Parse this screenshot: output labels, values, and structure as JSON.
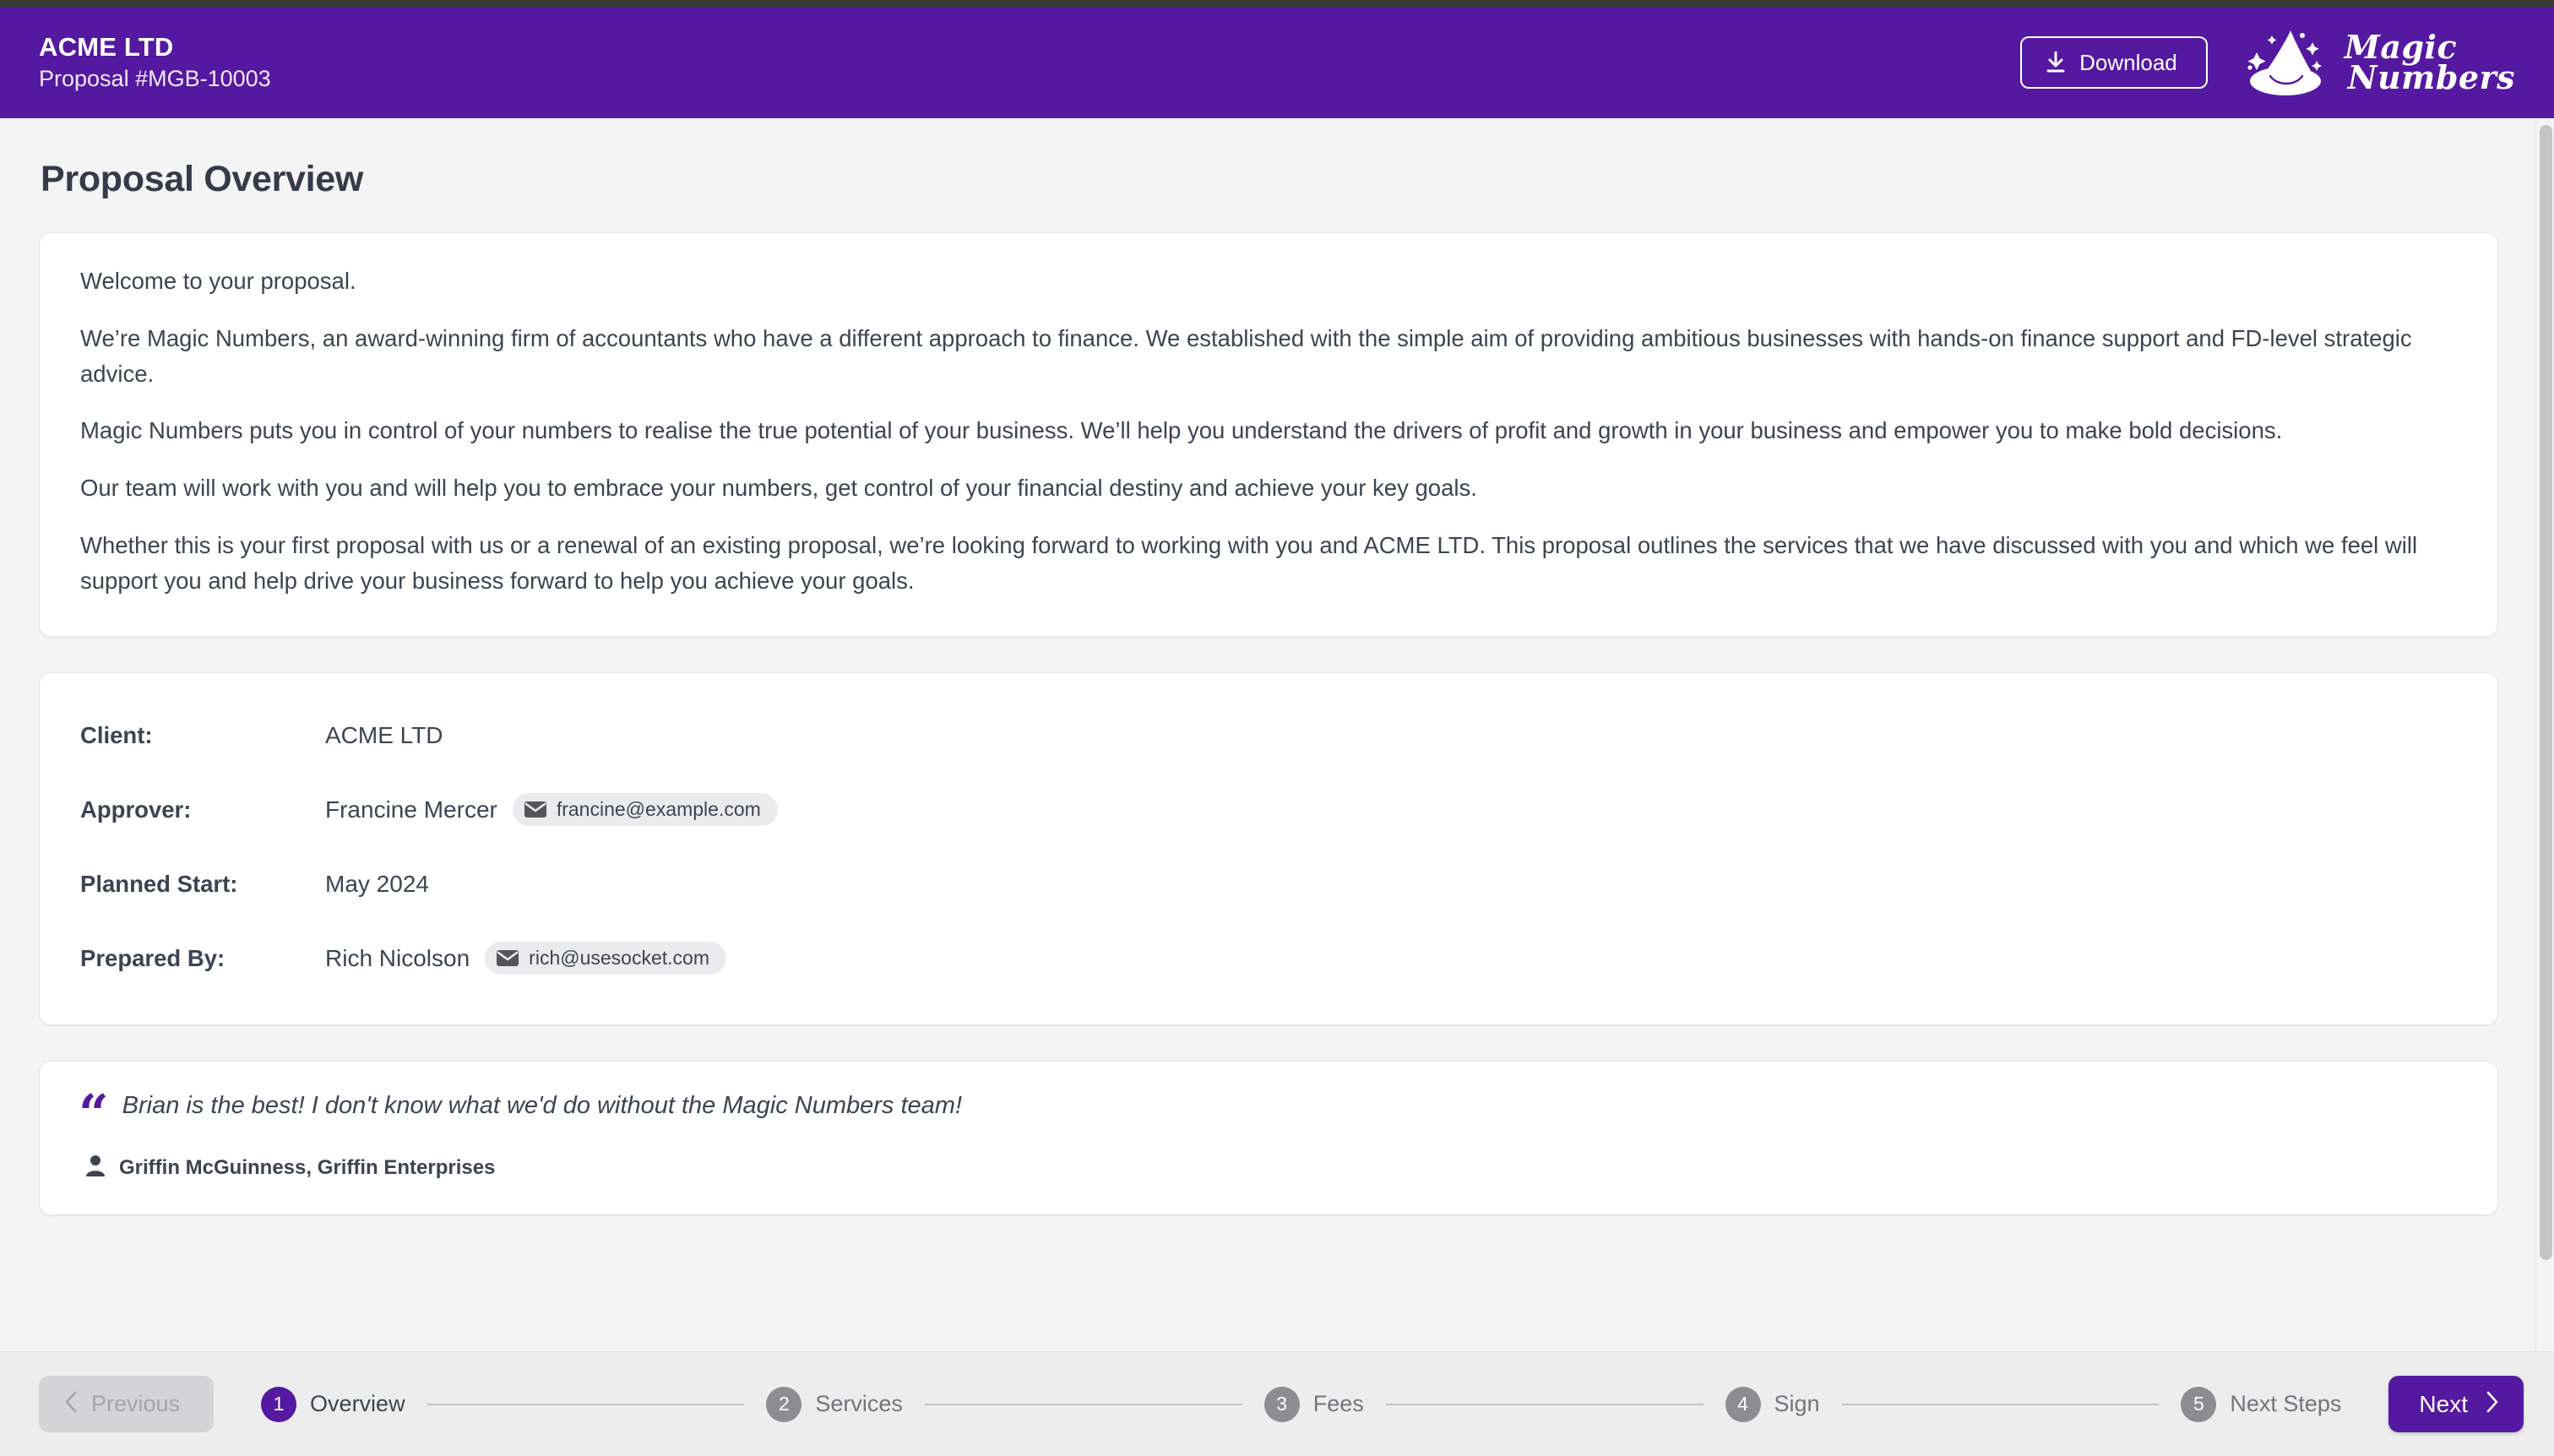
{
  "header": {
    "client_name": "ACME LTD",
    "proposal_number": "Proposal #MGB-10003",
    "download_label": "Download",
    "download_icon": "download-icon",
    "logo_line1": "Magic",
    "logo_line2": "Numbers",
    "logo_icon": "wizard-hat-icon",
    "brand_color": "#5419a0"
  },
  "page": {
    "title": "Proposal Overview"
  },
  "intro": {
    "paragraphs": [
      "Welcome to your proposal.",
      "We’re Magic Numbers, an award-winning firm of accountants who have a different approach to finance. We established with the simple aim of providing ambitious businesses with hands-on finance support and FD-level strategic advice.",
      "Magic Numbers puts you in control of your numbers to realise the true potential of your business. We’ll help you understand the drivers of profit and growth in your business and empower you to make bold decisions.",
      "Our team will work with you and will help you to embrace your numbers, get control of your financial destiny and achieve your key goals.",
      "Whether this is your first proposal with us or a renewal of an existing proposal, we’re looking forward to working with you and ACME LTD. This proposal outlines the services that we have discussed with you and which we feel will support you and help drive your business forward to help you achieve your goals."
    ]
  },
  "details": {
    "rows": [
      {
        "label": "Client:",
        "value": "ACME LTD",
        "email": ""
      },
      {
        "label": "Approver:",
        "value": "Francine Mercer",
        "email": "francine@example.com"
      },
      {
        "label": "Planned Start:",
        "value": "May 2024",
        "email": ""
      },
      {
        "label": "Prepared By:",
        "value": "Rich Nicolson",
        "email": "rich@usesocket.com"
      }
    ]
  },
  "testimonial": {
    "quote_mark": "“",
    "quote": "Brian is the best! I don't know what we'd do without the Magic Numbers team!",
    "author": "Griffin McGuinness, Griffin Enterprises",
    "author_icon": "person-icon"
  },
  "footer": {
    "previous_label": "Previous",
    "previous_icon": "chevron-left-icon",
    "previous_disabled": true,
    "next_label": "Next",
    "next_icon": "chevron-right-icon",
    "steps": [
      {
        "number": "1",
        "label": "Overview",
        "active": true
      },
      {
        "number": "2",
        "label": "Services",
        "active": false
      },
      {
        "number": "3",
        "label": "Fees",
        "active": false
      },
      {
        "number": "4",
        "label": "Sign",
        "active": false
      },
      {
        "number": "5",
        "label": "Next Steps",
        "active": false
      }
    ]
  }
}
